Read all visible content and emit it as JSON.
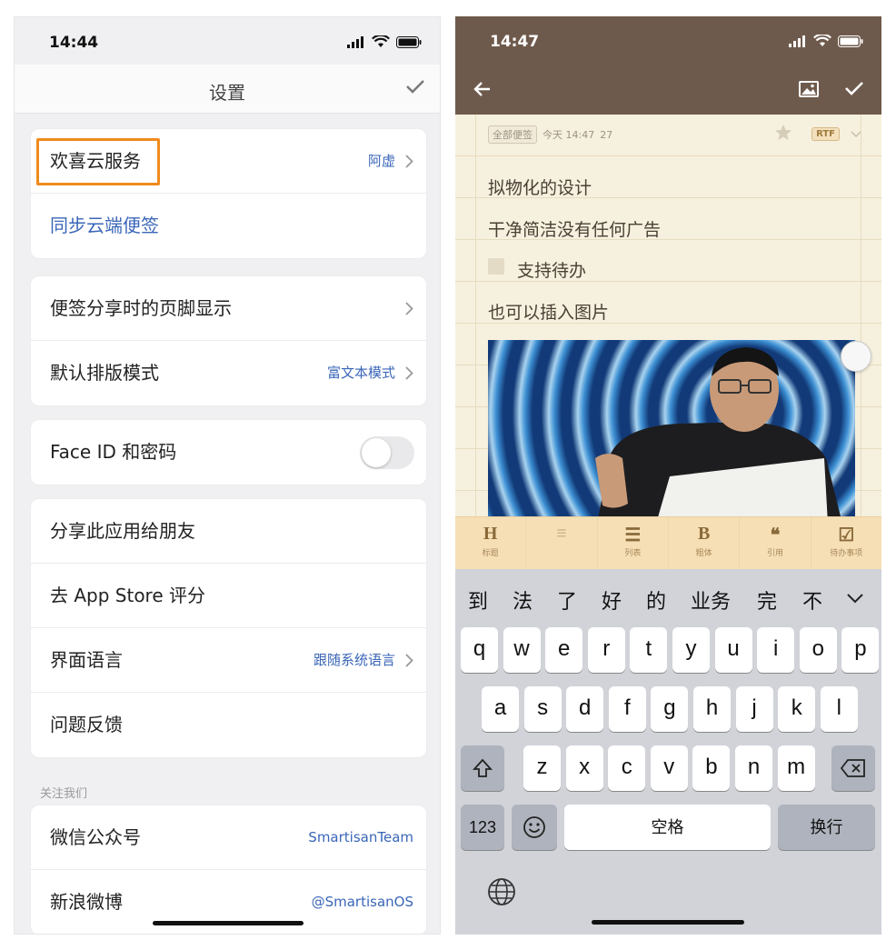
{
  "left": {
    "status": {
      "time": "14:44"
    },
    "nav": {
      "title": "设置",
      "confirm_icon": "checkmark-icon"
    },
    "cloud": {
      "service_label": "欢喜云服务",
      "account": "阿虚",
      "sync_label": "同步云端便签"
    },
    "layout": {
      "footer_label": "便签分享时的页脚显示",
      "mode_label": "默认排版模式",
      "mode_value": "富文本模式"
    },
    "security": {
      "faceid_label": "Face ID 和密码",
      "faceid_enabled": false
    },
    "misc": {
      "share_label": "分享此应用给朋友",
      "rate_label": "去 App Store 评分",
      "language_label": "界面语言",
      "language_value": "跟随系统语言",
      "feedback_label": "问题反馈"
    },
    "follow": {
      "header": "关注我们",
      "wechat_label": "微信公众号",
      "wechat_value": "SmartisanTeam",
      "weibo_label": "新浪微博",
      "weibo_value": "@SmartisanOS"
    },
    "highlight_color": "#f08a1c"
  },
  "right": {
    "status": {
      "time": "14:47"
    },
    "nav": {
      "back_icon": "back-arrow-icon",
      "image_icon": "image-icon",
      "confirm_icon": "checkmark-icon"
    },
    "meta": {
      "folder": "全部便签",
      "date": "今天 14:47",
      "count": "27",
      "format": "RTF"
    },
    "note": {
      "line1": "拟物化的设计",
      "line2": "干净简洁没有任何广告",
      "todo": "支持待办",
      "line4": "也可以插入图片"
    },
    "toolbar": [
      {
        "icon": "H",
        "label": "标题"
      },
      {
        "icon": "≡",
        "label": ""
      },
      {
        "icon": "☰",
        "label": "列表"
      },
      {
        "icon": "B",
        "label": "粗体"
      },
      {
        "icon": "❝",
        "label": "引用"
      },
      {
        "icon": "☑",
        "label": "待办事项"
      }
    ],
    "candidates": [
      "到",
      "法",
      "了",
      "好",
      "的",
      "业务",
      "完",
      "不"
    ],
    "keyboard": {
      "row1": [
        "q",
        "w",
        "e",
        "r",
        "t",
        "y",
        "u",
        "i",
        "o",
        "p"
      ],
      "row2": [
        "a",
        "s",
        "d",
        "f",
        "g",
        "h",
        "j",
        "k",
        "l"
      ],
      "row3": [
        "z",
        "x",
        "c",
        "v",
        "b",
        "n",
        "m"
      ],
      "num_key": "123",
      "space_key": "空格",
      "return_key": "换行",
      "shift_icon": "shift-icon",
      "delete_icon": "delete-icon",
      "emoji_icon": "emoji-icon",
      "globe_icon": "globe-icon"
    },
    "colors": {
      "header": "#6e5a4c",
      "paper": "#f6f0de",
      "toolbar": "#f6dfb5"
    }
  }
}
